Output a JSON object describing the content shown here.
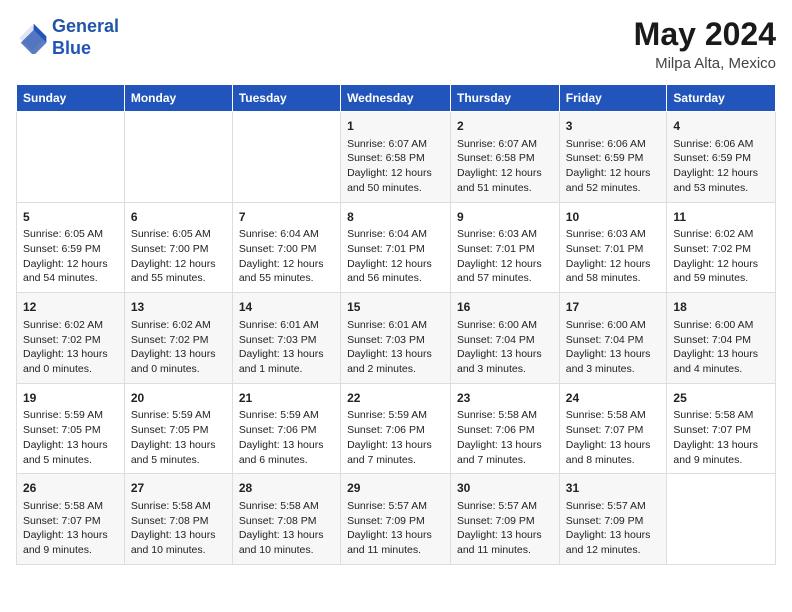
{
  "header": {
    "logo_general": "General",
    "logo_blue": "Blue",
    "month_year": "May 2024",
    "location": "Milpa Alta, Mexico"
  },
  "days_of_week": [
    "Sunday",
    "Monday",
    "Tuesday",
    "Wednesday",
    "Thursday",
    "Friday",
    "Saturday"
  ],
  "weeks": [
    [
      {
        "day": "",
        "info": ""
      },
      {
        "day": "",
        "info": ""
      },
      {
        "day": "",
        "info": ""
      },
      {
        "day": "1",
        "info": "Sunrise: 6:07 AM\nSunset: 6:58 PM\nDaylight: 12 hours\nand 50 minutes."
      },
      {
        "day": "2",
        "info": "Sunrise: 6:07 AM\nSunset: 6:58 PM\nDaylight: 12 hours\nand 51 minutes."
      },
      {
        "day": "3",
        "info": "Sunrise: 6:06 AM\nSunset: 6:59 PM\nDaylight: 12 hours\nand 52 minutes."
      },
      {
        "day": "4",
        "info": "Sunrise: 6:06 AM\nSunset: 6:59 PM\nDaylight: 12 hours\nand 53 minutes."
      }
    ],
    [
      {
        "day": "5",
        "info": "Sunrise: 6:05 AM\nSunset: 6:59 PM\nDaylight: 12 hours\nand 54 minutes."
      },
      {
        "day": "6",
        "info": "Sunrise: 6:05 AM\nSunset: 7:00 PM\nDaylight: 12 hours\nand 55 minutes."
      },
      {
        "day": "7",
        "info": "Sunrise: 6:04 AM\nSunset: 7:00 PM\nDaylight: 12 hours\nand 55 minutes."
      },
      {
        "day": "8",
        "info": "Sunrise: 6:04 AM\nSunset: 7:01 PM\nDaylight: 12 hours\nand 56 minutes."
      },
      {
        "day": "9",
        "info": "Sunrise: 6:03 AM\nSunset: 7:01 PM\nDaylight: 12 hours\nand 57 minutes."
      },
      {
        "day": "10",
        "info": "Sunrise: 6:03 AM\nSunset: 7:01 PM\nDaylight: 12 hours\nand 58 minutes."
      },
      {
        "day": "11",
        "info": "Sunrise: 6:02 AM\nSunset: 7:02 PM\nDaylight: 12 hours\nand 59 minutes."
      }
    ],
    [
      {
        "day": "12",
        "info": "Sunrise: 6:02 AM\nSunset: 7:02 PM\nDaylight: 13 hours\nand 0 minutes."
      },
      {
        "day": "13",
        "info": "Sunrise: 6:02 AM\nSunset: 7:02 PM\nDaylight: 13 hours\nand 0 minutes."
      },
      {
        "day": "14",
        "info": "Sunrise: 6:01 AM\nSunset: 7:03 PM\nDaylight: 13 hours\nand 1 minute."
      },
      {
        "day": "15",
        "info": "Sunrise: 6:01 AM\nSunset: 7:03 PM\nDaylight: 13 hours\nand 2 minutes."
      },
      {
        "day": "16",
        "info": "Sunrise: 6:00 AM\nSunset: 7:04 PM\nDaylight: 13 hours\nand 3 minutes."
      },
      {
        "day": "17",
        "info": "Sunrise: 6:00 AM\nSunset: 7:04 PM\nDaylight: 13 hours\nand 3 minutes."
      },
      {
        "day": "18",
        "info": "Sunrise: 6:00 AM\nSunset: 7:04 PM\nDaylight: 13 hours\nand 4 minutes."
      }
    ],
    [
      {
        "day": "19",
        "info": "Sunrise: 5:59 AM\nSunset: 7:05 PM\nDaylight: 13 hours\nand 5 minutes."
      },
      {
        "day": "20",
        "info": "Sunrise: 5:59 AM\nSunset: 7:05 PM\nDaylight: 13 hours\nand 5 minutes."
      },
      {
        "day": "21",
        "info": "Sunrise: 5:59 AM\nSunset: 7:06 PM\nDaylight: 13 hours\nand 6 minutes."
      },
      {
        "day": "22",
        "info": "Sunrise: 5:59 AM\nSunset: 7:06 PM\nDaylight: 13 hours\nand 7 minutes."
      },
      {
        "day": "23",
        "info": "Sunrise: 5:58 AM\nSunset: 7:06 PM\nDaylight: 13 hours\nand 7 minutes."
      },
      {
        "day": "24",
        "info": "Sunrise: 5:58 AM\nSunset: 7:07 PM\nDaylight: 13 hours\nand 8 minutes."
      },
      {
        "day": "25",
        "info": "Sunrise: 5:58 AM\nSunset: 7:07 PM\nDaylight: 13 hours\nand 9 minutes."
      }
    ],
    [
      {
        "day": "26",
        "info": "Sunrise: 5:58 AM\nSunset: 7:07 PM\nDaylight: 13 hours\nand 9 minutes."
      },
      {
        "day": "27",
        "info": "Sunrise: 5:58 AM\nSunset: 7:08 PM\nDaylight: 13 hours\nand 10 minutes."
      },
      {
        "day": "28",
        "info": "Sunrise: 5:58 AM\nSunset: 7:08 PM\nDaylight: 13 hours\nand 10 minutes."
      },
      {
        "day": "29",
        "info": "Sunrise: 5:57 AM\nSunset: 7:09 PM\nDaylight: 13 hours\nand 11 minutes."
      },
      {
        "day": "30",
        "info": "Sunrise: 5:57 AM\nSunset: 7:09 PM\nDaylight: 13 hours\nand 11 minutes."
      },
      {
        "day": "31",
        "info": "Sunrise: 5:57 AM\nSunset: 7:09 PM\nDaylight: 13 hours\nand 12 minutes."
      },
      {
        "day": "",
        "info": ""
      }
    ]
  ]
}
